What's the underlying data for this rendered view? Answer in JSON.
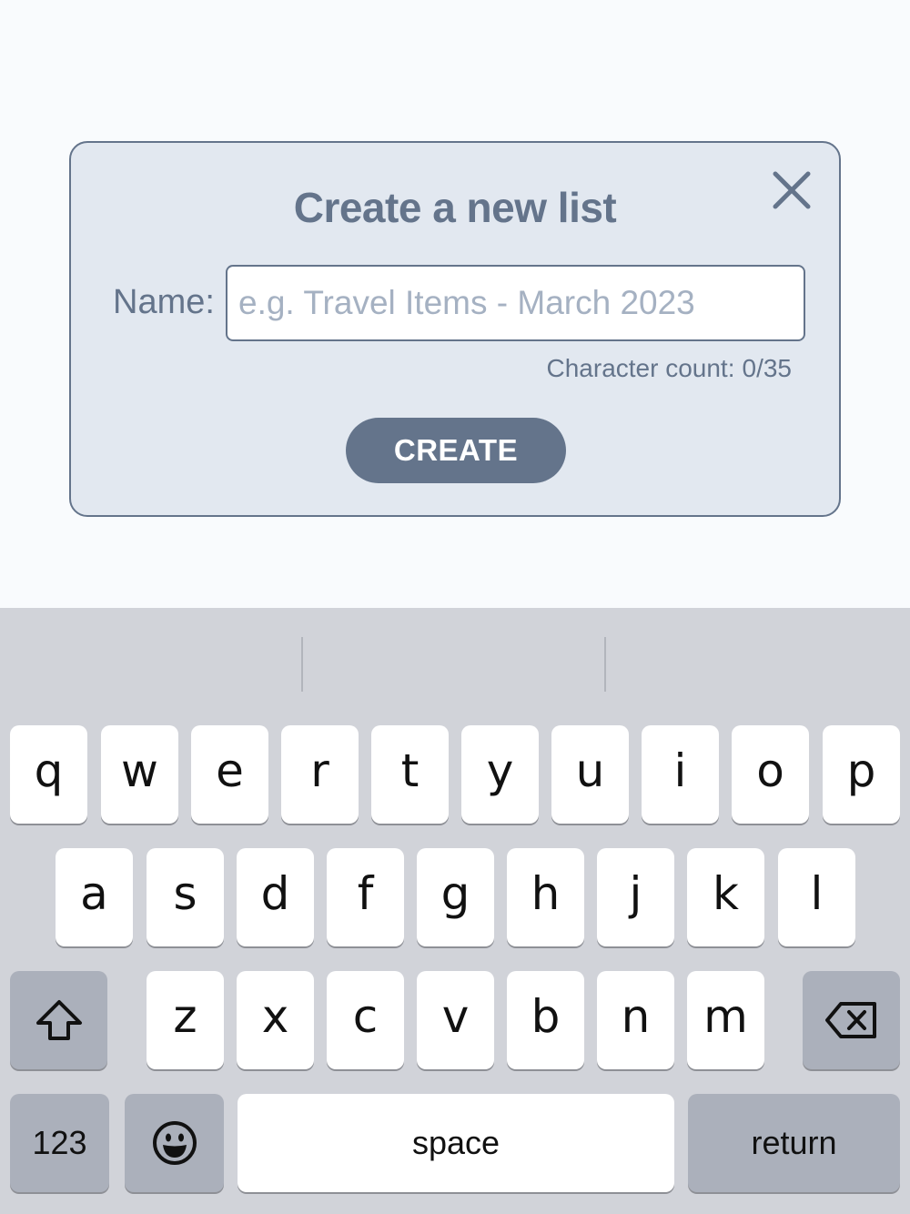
{
  "modal": {
    "title": "Create a new list",
    "name_label": "Name:",
    "name_placeholder": "e.g. Travel Items - March 2023",
    "name_value": "",
    "char_count_label": "Character count:",
    "char_count_value": "0/35",
    "create_label": "CREATE",
    "close_icon": "close-icon"
  },
  "keyboard": {
    "row1": [
      "q",
      "w",
      "e",
      "r",
      "t",
      "y",
      "u",
      "i",
      "o",
      "p"
    ],
    "row2": [
      "a",
      "s",
      "d",
      "f",
      "g",
      "h",
      "j",
      "k",
      "l"
    ],
    "row3": [
      "z",
      "x",
      "c",
      "v",
      "b",
      "n",
      "m"
    ],
    "shift_icon": "shift-icon",
    "backspace_icon": "backspace-icon",
    "emoji_icon": "emoji-icon",
    "numbers_label": "123",
    "space_label": "space",
    "return_label": "return"
  },
  "colors": {
    "accent": "#64748b",
    "modal_bg": "#e2e8f0",
    "page_bg": "#f9fbfd",
    "keyboard_bg": "#d1d3d9",
    "key_gray": "#abb0bb"
  }
}
